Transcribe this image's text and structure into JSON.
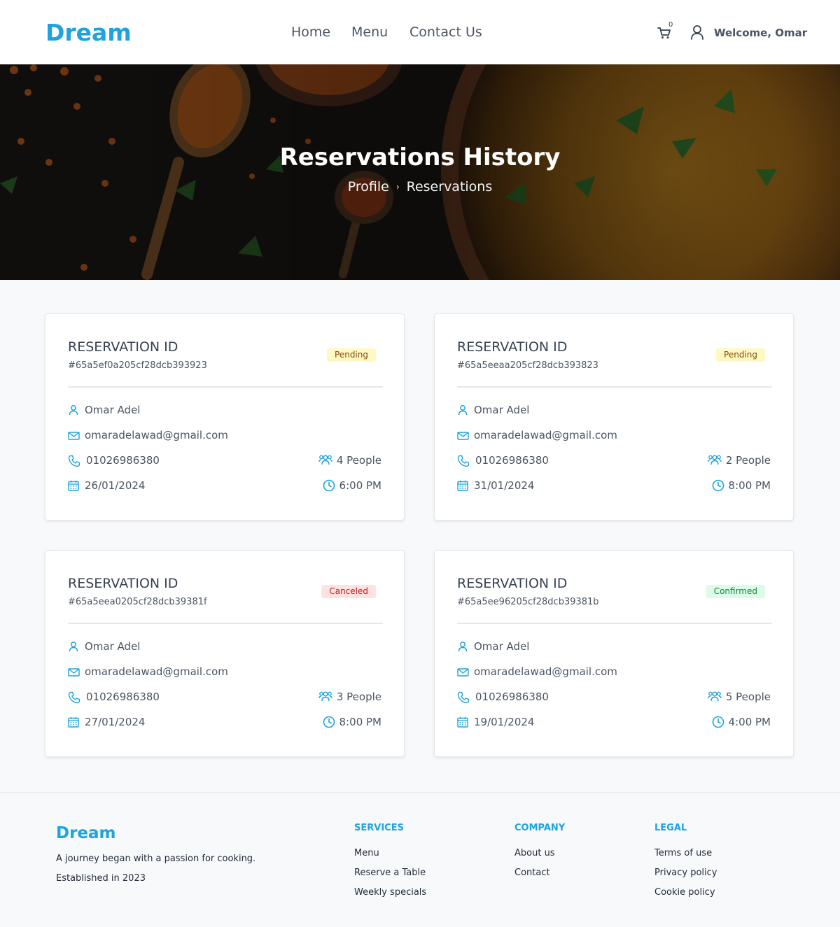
{
  "header": {
    "brand": "Dream",
    "nav": [
      "Home",
      "Menu",
      "Contact Us"
    ],
    "cart_count": "0",
    "welcome": "Welcome, Omar"
  },
  "hero": {
    "title": "Reservations History",
    "breadcrumb": [
      "Profile",
      "Reservations"
    ]
  },
  "colors": {
    "accent": "#1ea3df",
    "pending_bg": "#fef9c3",
    "canceled_bg": "#fee2e2",
    "confirmed_bg": "#dcfce7"
  },
  "reservations": [
    {
      "title": "RESERVATION ID",
      "id": "#65a5ef0a205cf28dcb393923",
      "status": "Pending",
      "name": "Omar Adel",
      "email": "omaradelawad@gmail.com",
      "phone": "01026986380",
      "people": "4 People",
      "date": "26/01/2024",
      "time": "6:00 PM"
    },
    {
      "title": "RESERVATION ID",
      "id": "#65a5eeaa205cf28dcb393823",
      "status": "Pending",
      "name": "Omar Adel",
      "email": "omaradelawad@gmail.com",
      "phone": "01026986380",
      "people": "2 People",
      "date": "31/01/2024",
      "time": "8:00 PM"
    },
    {
      "title": "RESERVATION ID",
      "id": "#65a5eea0205cf28dcb39381f",
      "status": "Canceled",
      "name": "Omar Adel",
      "email": "omaradelawad@gmail.com",
      "phone": "01026986380",
      "people": "3 People",
      "date": "27/01/2024",
      "time": "8:00 PM"
    },
    {
      "title": "RESERVATION ID",
      "id": "#65a5ee96205cf28dcb39381b",
      "status": "Confirmed",
      "name": "Omar Adel",
      "email": "omaradelawad@gmail.com",
      "phone": "01026986380",
      "people": "5 People",
      "date": "19/01/2024",
      "time": "4:00 PM"
    }
  ],
  "footer": {
    "brand": "Dream",
    "tagline": "A journey began with a passion for cooking.",
    "established": "Established in 2023",
    "services": {
      "heading": "SERVICES",
      "links": [
        "Menu",
        "Reserve a Table",
        "Weekly specials"
      ]
    },
    "company": {
      "heading": "COMPANY",
      "links": [
        "About us",
        "Contact"
      ]
    },
    "legal": {
      "heading": "LEGAL",
      "links": [
        "Terms of use",
        "Privacy policy",
        "Cookie policy"
      ]
    }
  },
  "icons": {
    "cart": "cart-icon",
    "user": "user-icon",
    "breadcrumb_separator": "chevron-right-icon",
    "person": "person-icon",
    "email": "envelope-icon",
    "phone": "phone-icon",
    "people": "people-icon",
    "date": "calendar-icon",
    "time": "clock-icon"
  }
}
